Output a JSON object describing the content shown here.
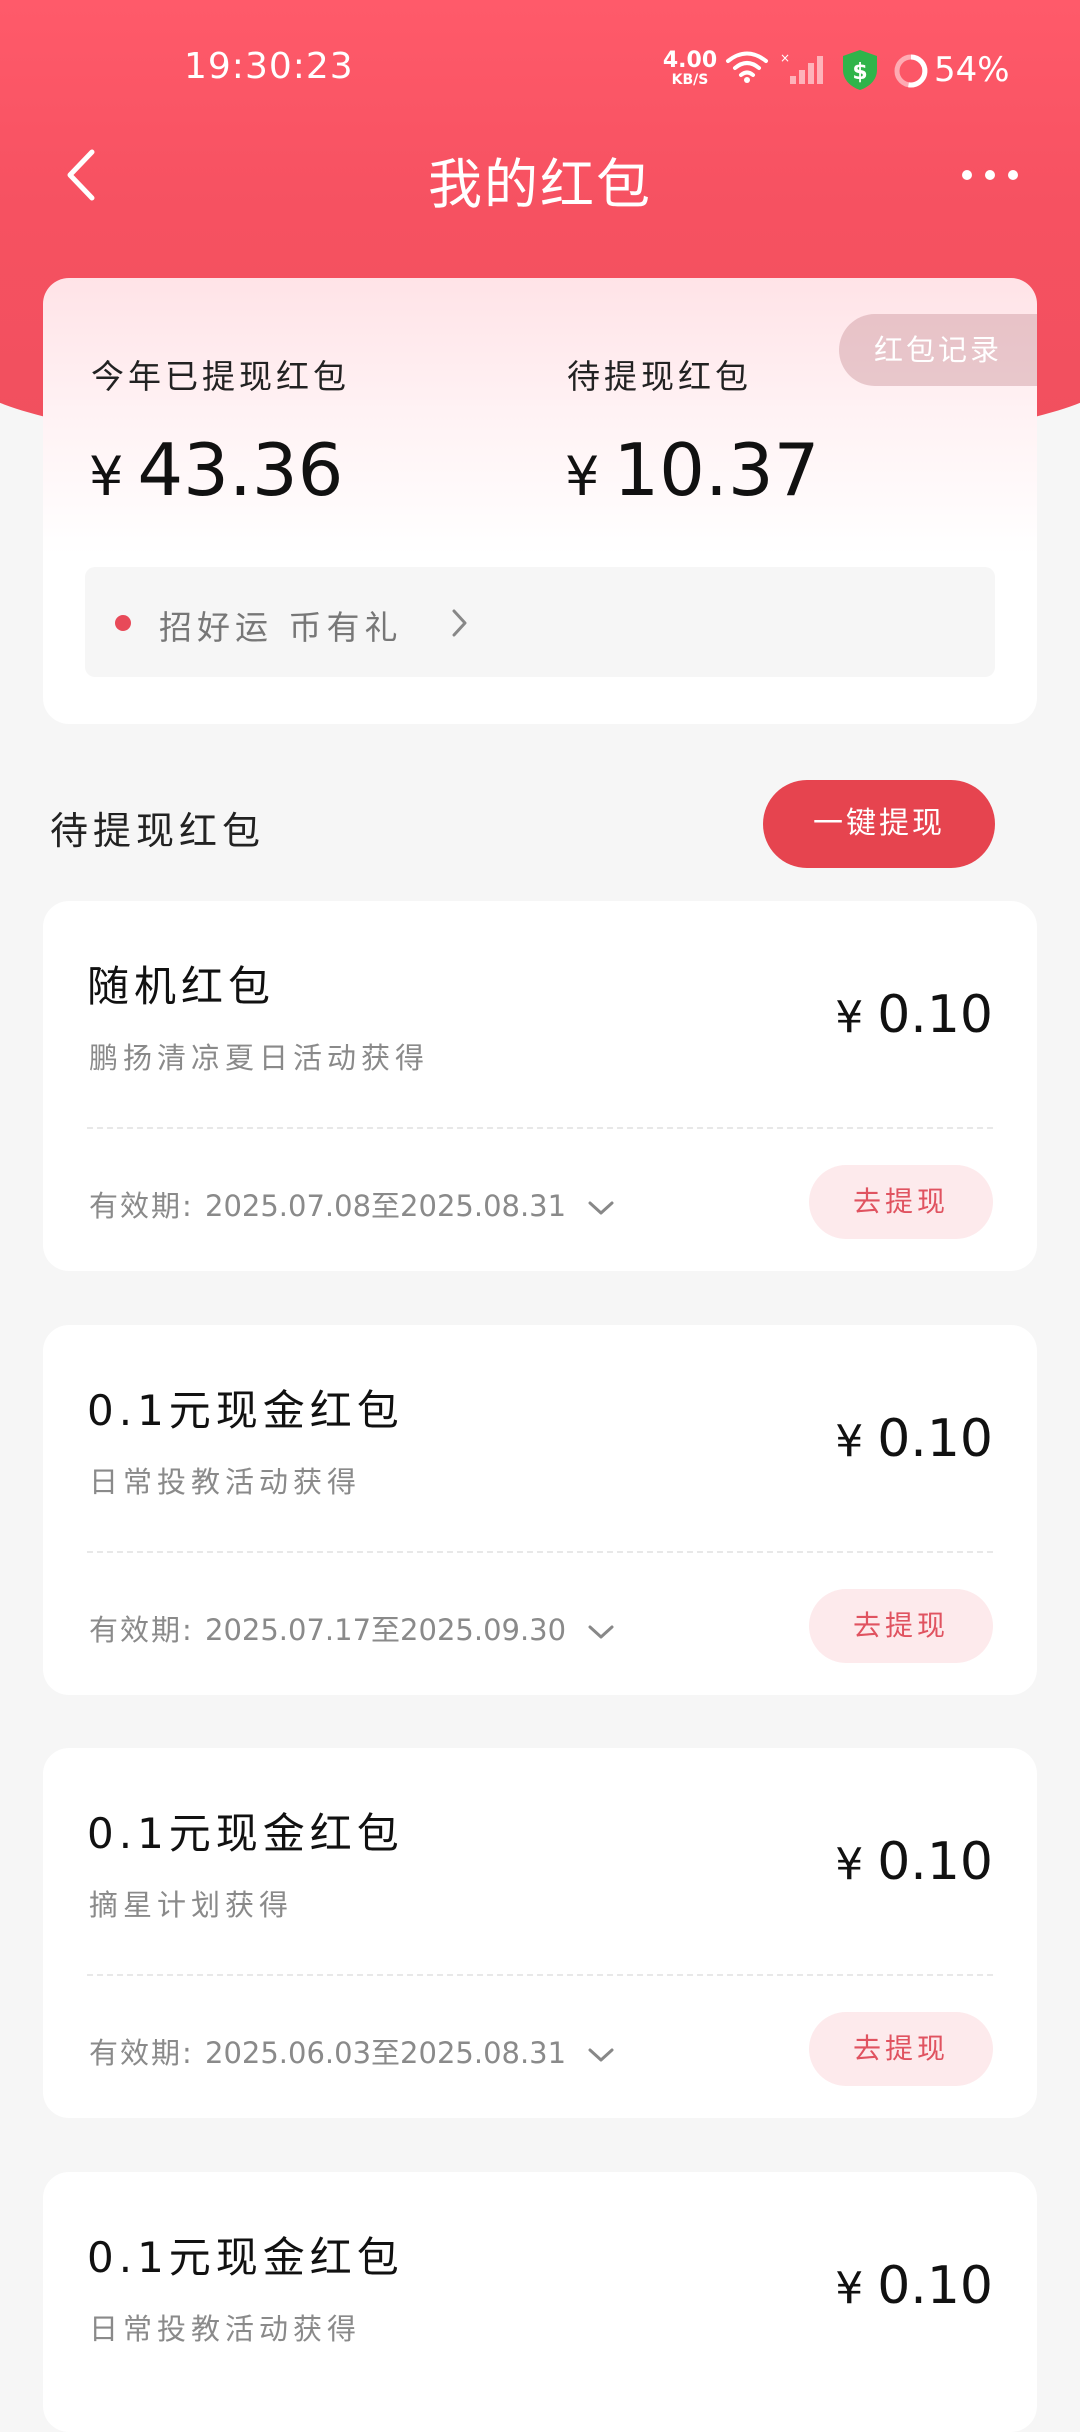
{
  "status_bar": {
    "time": "19:30:23",
    "net_speed": "4.00",
    "net_unit": "KB/S",
    "battery": "54%"
  },
  "header": {
    "title": "我的红包"
  },
  "summary": {
    "record_button": "红包记录",
    "withdrawn_label": "今年已提现红包",
    "withdrawn_currency": "¥",
    "withdrawn_amount": "43.36",
    "pending_label": "待提现红包",
    "pending_currency": "¥",
    "pending_amount": "10.37",
    "promo_text": "招好运 币有礼"
  },
  "section": {
    "title": "待提现红包",
    "withdraw_all_label": "一键提现"
  },
  "envelopes": [
    {
      "name": "随机红包",
      "source": "鹏扬清凉夏日活动获得",
      "currency": "¥",
      "amount": "0.10",
      "validity_label": "有效期:",
      "validity_dates": "2025.07.08至2025.08.31",
      "action": "去提现"
    },
    {
      "name": "0.1元现金红包",
      "source": "日常投教活动获得",
      "currency": "¥",
      "amount": "0.10",
      "validity_label": "有效期:",
      "validity_dates": "2025.07.17至2025.09.30",
      "action": "去提现"
    },
    {
      "name": "0.1元现金红包",
      "source": "摘星计划获得",
      "currency": "¥",
      "amount": "0.10",
      "validity_label": "有效期:",
      "validity_dates": "2025.06.03至2025.08.31",
      "action": "去提现"
    },
    {
      "name": "0.1元现金红包",
      "source": "日常投教活动获得",
      "currency": "¥",
      "amount": "0.10"
    }
  ],
  "colors": {
    "brand_red": "#e6444f",
    "header_red": "#f65161",
    "soft_pink": "#fdeaec"
  },
  "icons": [
    "back-arrow-icon",
    "more-dots-icon",
    "wifi-icon",
    "signal-icon",
    "shield-dollar-icon",
    "battery-icon",
    "chevron-right-icon",
    "chevron-down-icon"
  ]
}
